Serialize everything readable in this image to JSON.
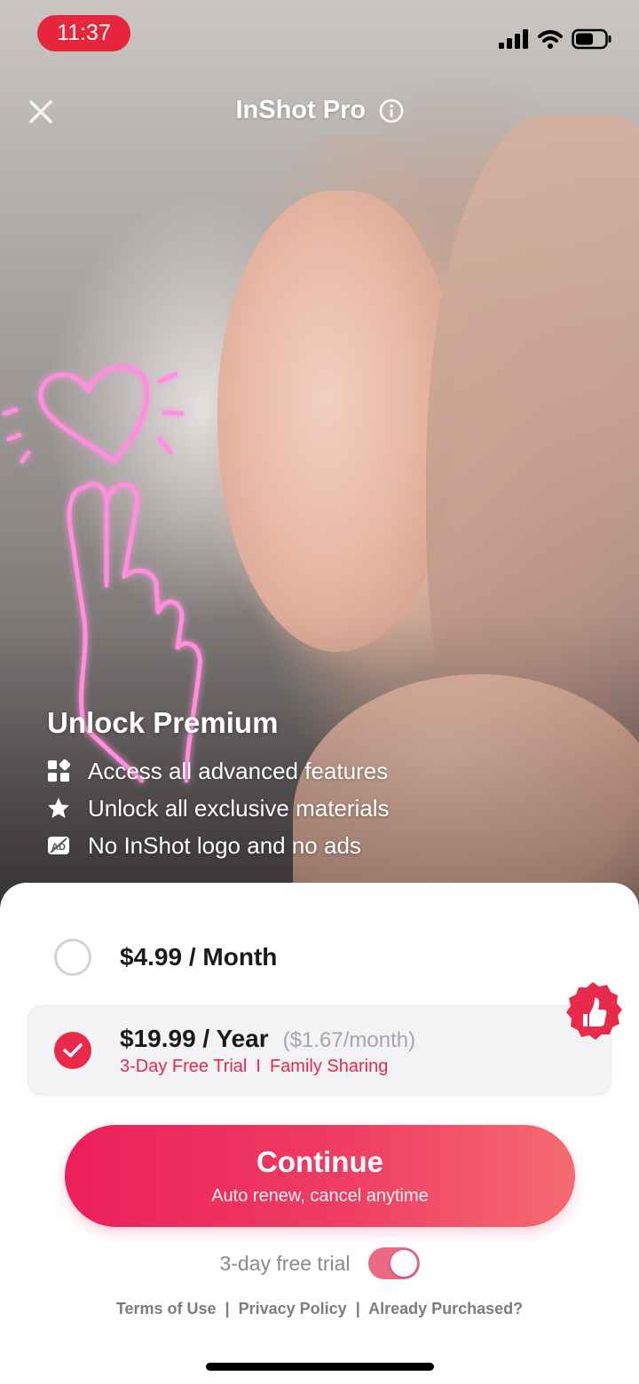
{
  "status_bar": {
    "time": "11:37"
  },
  "header": {
    "title": "InShot Pro"
  },
  "features": {
    "title": "Unlock Premium",
    "items": [
      {
        "icon": "grid-icon",
        "label": "Access all advanced features"
      },
      {
        "icon": "star-icon",
        "label": "Unlock all exclusive materials"
      },
      {
        "icon": "no-ads-icon",
        "label": "No InShot logo and no ads"
      }
    ]
  },
  "plans": {
    "monthly": {
      "price": "$4.99 / Month",
      "selected": false
    },
    "yearly": {
      "price": "$19.99 / Year",
      "per_month": "($1.67/month)",
      "trial": "3-Day Free Trial",
      "separator": "I",
      "sharing": "Family Sharing",
      "selected": true
    }
  },
  "continue_button": {
    "label": "Continue",
    "sublabel": "Auto renew, cancel anytime"
  },
  "trial_toggle": {
    "label": "3-day free trial",
    "on": true
  },
  "links": {
    "terms": "Terms of Use",
    "privacy": "Privacy Policy",
    "purchased": "Already Purchased?",
    "separator": "|"
  },
  "colors": {
    "accent": "#ea2a4b",
    "status_pill": "#e8253a",
    "neon": "#ff7fd6"
  }
}
